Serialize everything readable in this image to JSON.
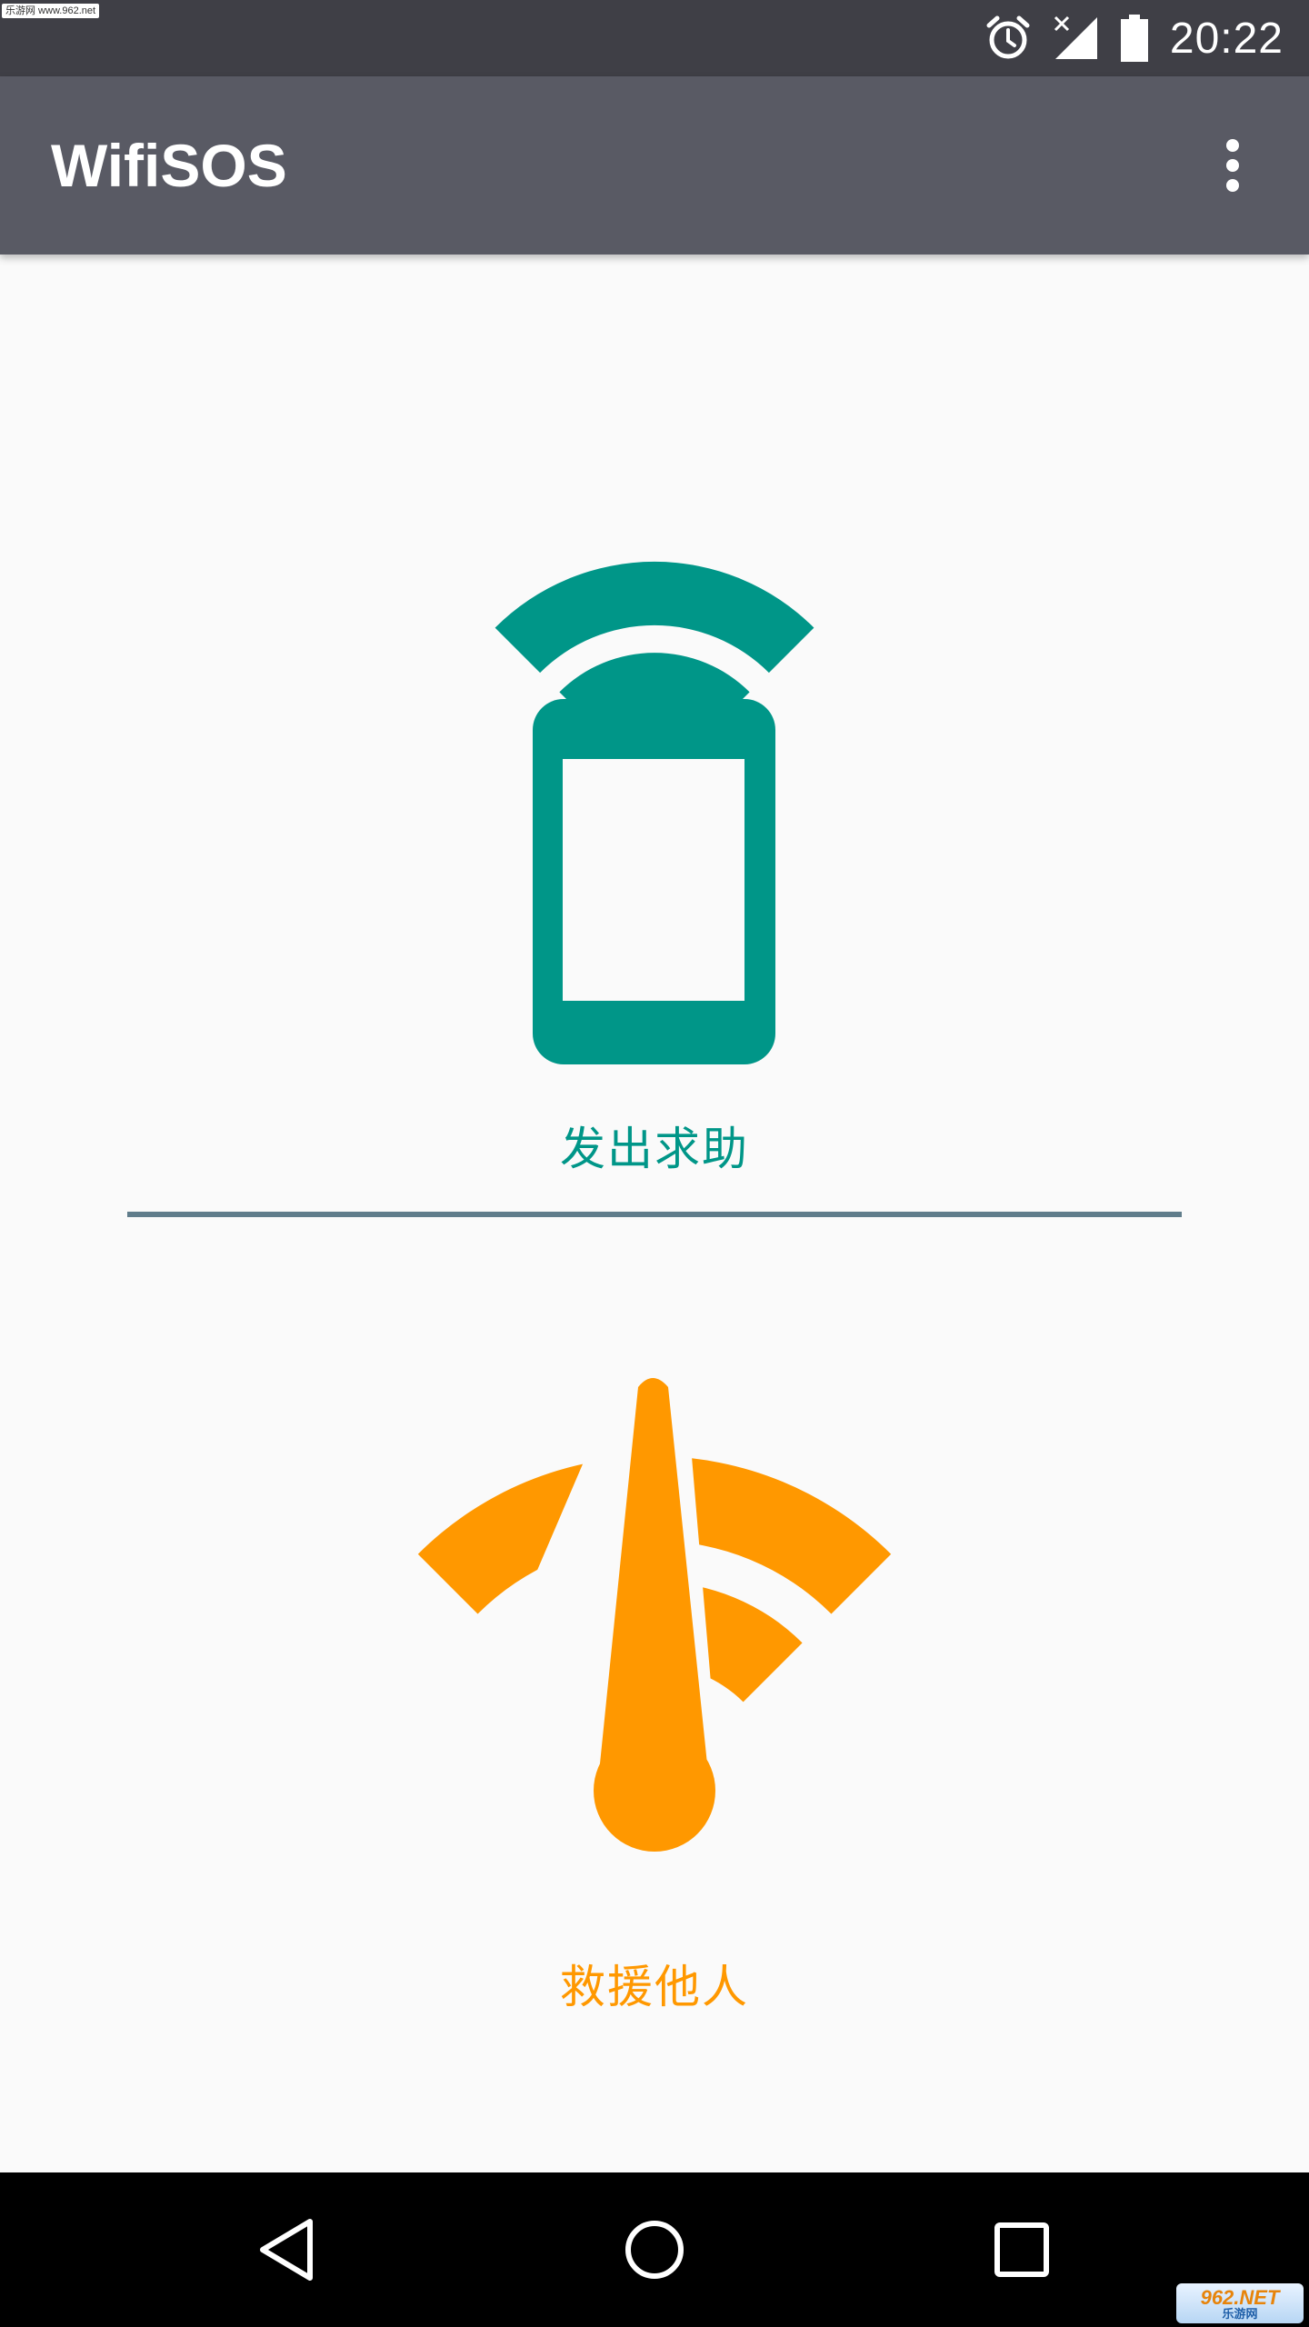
{
  "status_bar": {
    "watermark": "乐游网 www.962.net",
    "time": "20:22",
    "icons": [
      "alarm-icon",
      "no-sim-signal-icon",
      "battery-icon"
    ]
  },
  "app_bar": {
    "title": "WifiSOS",
    "menu_icon": "overflow-menu-icon"
  },
  "sections": {
    "send_help": {
      "label": "发出求助",
      "icon": "phone-broadcast-icon",
      "color": "#009688"
    },
    "rescue_others": {
      "label": "救援他人",
      "icon": "wifi-gauge-icon",
      "color": "#ff9800"
    }
  },
  "divider_color": "#607d8b",
  "nav_bar": {
    "icons": [
      "back-icon",
      "home-icon",
      "recents-icon"
    ]
  },
  "watermark_bottom": {
    "main": "962.NET",
    "sub": "乐游网"
  }
}
